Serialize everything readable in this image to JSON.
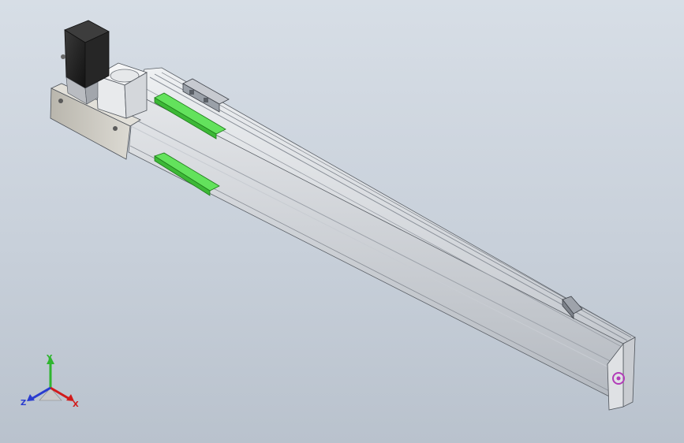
{
  "viewport": {
    "background_top": "#d7dee6",
    "background_bottom": "#b9c2cd"
  },
  "model": {
    "components": [
      "stepper-motor",
      "motor-mount-plate",
      "coupling-housing",
      "linear-rail-body",
      "carriage-slider",
      "limit-sensor-bracket",
      "end-cap"
    ],
    "colors": {
      "rail": "#d8dbe0",
      "rail_dark": "#a8adb5",
      "motor": "#2a2a2a",
      "mount_plate": "#c9c7c0",
      "bracket_green": "#4fd84a",
      "end_cap_logo": "#b23bb8"
    }
  },
  "triad": {
    "x_label": "X",
    "y_label": "Y",
    "z_label": "Z",
    "x_color": "#d11b1b",
    "y_color": "#2fb52f",
    "z_color": "#2a3ccf"
  }
}
